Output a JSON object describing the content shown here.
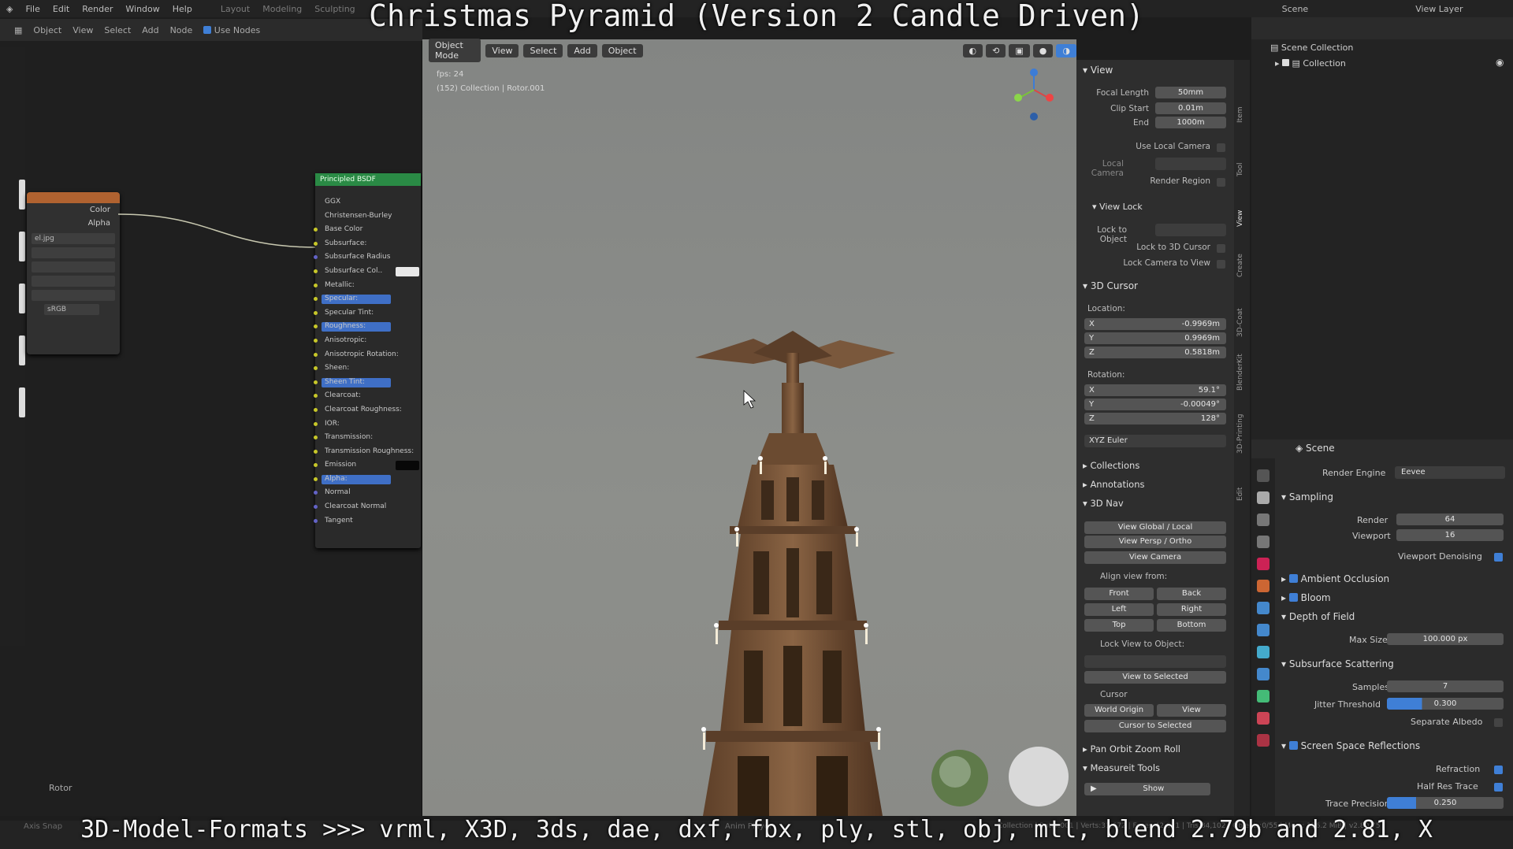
{
  "title_overlay": "Christmas Pyramid (Version 2 Candle Driven)",
  "bottom_caption": "3D-Model-Formats >>> vrml, X3D, 3ds, dae, dxf, fbx, ply, stl, obj, mtl, blend 2.79b and 2.81, X",
  "menubar": {
    "items": [
      "File",
      "Edit",
      "Render",
      "Window",
      "Help"
    ],
    "workspaces": [
      "Layout",
      "Modeling",
      "Sculpting"
    ],
    "scene": "Scene",
    "view_layer": "View Layer"
  },
  "node_editor": {
    "header": {
      "object_label": "Object",
      "view": "View",
      "select": "Select",
      "add": "Add",
      "node": "Node",
      "use_nodes": "Use Nodes"
    },
    "image_node": {
      "outputs": [
        "Color",
        "Alpha"
      ],
      "image_name": "el.jpg",
      "colorspace": "sRGB"
    },
    "bsdf": {
      "title": "Principled BSDF",
      "distribution": "GGX",
      "subsurface_method": "Christensen-Burley",
      "inputs": [
        "Base Color",
        "Subsurface:",
        "Subsurface Radius",
        "Subsurface Col..",
        "Metallic:",
        "Specular:",
        "Specular Tint:",
        "Roughness:",
        "Anisotropic:",
        "Anisotropic Rotation:",
        "Sheen:",
        "Sheen Tint:",
        "Clearcoat:",
        "Clearcoat Roughness:",
        "IOR:",
        "Transmission:",
        "Transmission Roughness:",
        "Emission",
        "Alpha:",
        "Normal",
        "Clearcoat Normal",
        "Tangent"
      ]
    },
    "bottom_label": "Rotor"
  },
  "viewport": {
    "header": {
      "mode": "Object Mode",
      "view": "View",
      "select": "Select",
      "add": "Add",
      "object": "Object"
    },
    "info_fps": "fps: 24",
    "info_object": "(152) Collection | Rotor.001"
  },
  "npanel": {
    "tabs": [
      "Item",
      "Tool",
      "View",
      "Create",
      "3D-Coat",
      "BlenderKit",
      "3D-Printing",
      "Edit"
    ],
    "view": {
      "title": "View",
      "focal_length_label": "Focal Length",
      "focal_length": "50mm",
      "clip_start_label": "Clip Start",
      "clip_start": "0.01m",
      "end_label": "End",
      "end": "1000m",
      "use_local_camera": "Use Local Camera",
      "local_camera": "Local Camera",
      "render_region": "Render Region"
    },
    "view_lock": {
      "title": "View Lock",
      "lock_to_object": "Lock to Object",
      "lock_to_3d_cursor": "Lock to 3D Cursor",
      "lock_camera_to_view": "Lock Camera to View"
    },
    "cursor": {
      "title": "3D Cursor",
      "location_label": "Location:",
      "loc_x": "-0.9969m",
      "loc_y": "0.9969m",
      "loc_z": "0.5818m",
      "rotation_label": "Rotation:",
      "rot_x": "59.1°",
      "rot_y": "-0.00049°",
      "rot_z": "128°",
      "rotation_mode": "XYZ Euler",
      "x": "X",
      "y": "Y",
      "z": "Z"
    },
    "collections": "Collections",
    "annotations": "Annotations",
    "nav": {
      "title": "3D Nav",
      "global_local": "View Global / Local",
      "persp_ortho": "View Persp / Ortho",
      "camera": "View Camera",
      "align_from": "Align view from:",
      "front": "Front",
      "back": "Back",
      "left": "Left",
      "right": "Right",
      "top": "Top",
      "bottom": "Bottom",
      "lock_view_to_object": "Lock View to Object:",
      "view_to_selected": "View to Selected",
      "cursor": "Cursor",
      "world_origin": "World Origin",
      "view": "View",
      "cursor_to_selected": "Cursor to Selected"
    },
    "pan_orbit": "Pan Orbit Zoom Roll",
    "measure": "Measureit Tools",
    "show": "Show"
  },
  "outliner": {
    "scene_collection": "Scene Collection",
    "collection": "Collection"
  },
  "properties": {
    "title": "Scene",
    "render_engine_label": "Render Engine",
    "render_engine": "Eevee",
    "sampling": "Sampling",
    "render_label": "Render",
    "render_samples": "64",
    "viewport_label": "Viewport",
    "viewport_samples": "16",
    "viewport_denoising": "Viewport Denoising",
    "ambient_occlusion": "Ambient Occlusion",
    "bloom": "Bloom",
    "depth_of_field": "Depth of Field",
    "max_size_label": "Max Size",
    "max_size": "100.000 px",
    "subsurface": "Subsurface Scattering",
    "samples_label": "Samples",
    "samples": "7",
    "jitter_label": "Jitter Threshold",
    "jitter": "0.300",
    "separate_albedo": "Separate Albedo",
    "ssr": "Screen Space Reflections",
    "refraction": "Refraction",
    "half_res": "Half Res Trace",
    "trace_precision_label": "Trace Precision",
    "trace_precision": "0.250"
  },
  "statusbar": {
    "left": "Axis Snap",
    "middle": "Anim Player",
    "right": "Collection | Rotor.001 | Verts:31,672 | Faces:42,621 | Tris:84,102 | Objects:0/55 | Mem: 126.2 MiB | v2.80.75"
  },
  "colors": {
    "accent": "#3f7fd6",
    "bsdf_header": "#2a8a45",
    "image_node_header": "#b06230",
    "viewport_bg": "#8a8b87"
  }
}
